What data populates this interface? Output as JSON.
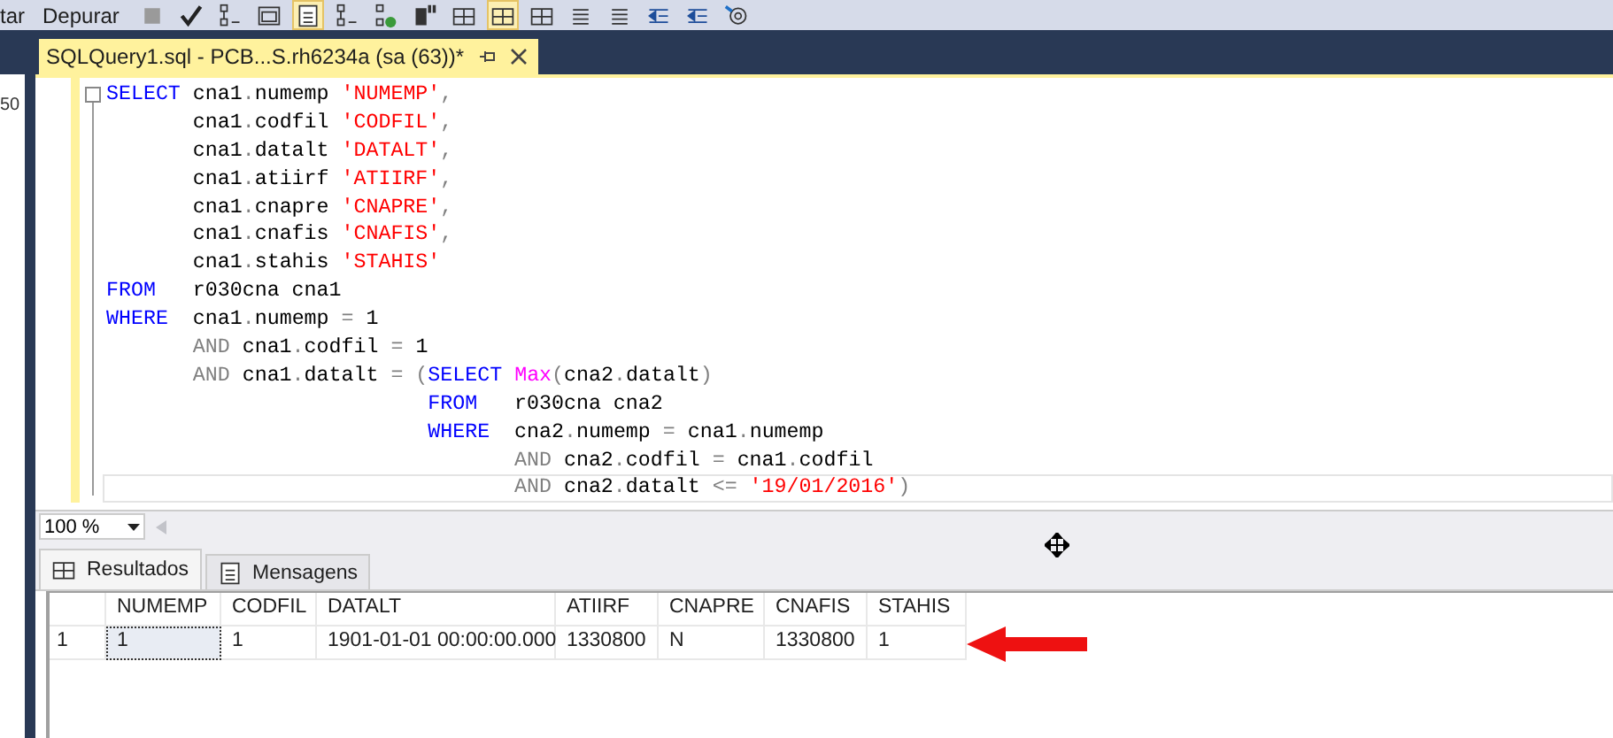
{
  "toolbar": {
    "menus": [
      "tar",
      "Depurar"
    ],
    "buttons": [
      {
        "kind": "stop",
        "on": false
      },
      {
        "kind": "check",
        "on": false
      },
      {
        "kind": "tree",
        "on": false
      },
      {
        "kind": "window",
        "on": false
      },
      {
        "kind": "doc",
        "on": true
      },
      {
        "kind": "tree",
        "on": false
      },
      {
        "kind": "tree-check",
        "on": false
      },
      {
        "kind": "device",
        "on": false
      },
      {
        "kind": "grid",
        "on": false
      },
      {
        "kind": "grid",
        "on": true
      },
      {
        "kind": "grid",
        "on": false
      },
      {
        "kind": "lines",
        "on": false
      },
      {
        "kind": "lines",
        "on": false
      },
      {
        "kind": "indent",
        "on": false
      },
      {
        "kind": "indent",
        "on": false
      },
      {
        "kind": "at",
        "on": false
      }
    ]
  },
  "left_panel": {
    "text": "50"
  },
  "tab": {
    "title": "SQLQuery1.sql - PCB...S.rh6234a (sa (63))*"
  },
  "editor": {
    "lines": [
      {
        "current": false,
        "tokens": [
          {
            "kind": "keyword",
            "text": "SELECT"
          },
          {
            "kind": "plain",
            "text": " cna1"
          },
          {
            "kind": "op",
            "text": "."
          },
          {
            "kind": "plain",
            "text": "numemp "
          },
          {
            "kind": "string",
            "text": "'NUMEMP'"
          },
          {
            "kind": "op",
            "text": ","
          }
        ]
      },
      {
        "current": false,
        "tokens": [
          {
            "kind": "plain",
            "text": "       cna1"
          },
          {
            "kind": "op",
            "text": "."
          },
          {
            "kind": "plain",
            "text": "codfil "
          },
          {
            "kind": "string",
            "text": "'CODFIL'"
          },
          {
            "kind": "op",
            "text": ","
          }
        ]
      },
      {
        "current": false,
        "tokens": [
          {
            "kind": "plain",
            "text": "       cna1"
          },
          {
            "kind": "op",
            "text": "."
          },
          {
            "kind": "plain",
            "text": "datalt "
          },
          {
            "kind": "string",
            "text": "'DATALT'"
          },
          {
            "kind": "op",
            "text": ","
          }
        ]
      },
      {
        "current": false,
        "tokens": [
          {
            "kind": "plain",
            "text": "       cna1"
          },
          {
            "kind": "op",
            "text": "."
          },
          {
            "kind": "plain",
            "text": "atiirf "
          },
          {
            "kind": "string",
            "text": "'ATIIRF'"
          },
          {
            "kind": "op",
            "text": ","
          }
        ]
      },
      {
        "current": false,
        "tokens": [
          {
            "kind": "plain",
            "text": "       cna1"
          },
          {
            "kind": "op",
            "text": "."
          },
          {
            "kind": "plain",
            "text": "cnapre "
          },
          {
            "kind": "string",
            "text": "'CNAPRE'"
          },
          {
            "kind": "op",
            "text": ","
          }
        ]
      },
      {
        "current": false,
        "tokens": [
          {
            "kind": "plain",
            "text": "       cna1"
          },
          {
            "kind": "op",
            "text": "."
          },
          {
            "kind": "plain",
            "text": "cnafis "
          },
          {
            "kind": "string",
            "text": "'CNAFIS'"
          },
          {
            "kind": "op",
            "text": ","
          }
        ]
      },
      {
        "current": false,
        "tokens": [
          {
            "kind": "plain",
            "text": "       cna1"
          },
          {
            "kind": "op",
            "text": "."
          },
          {
            "kind": "plain",
            "text": "stahis "
          },
          {
            "kind": "string",
            "text": "'STAHIS'"
          }
        ]
      },
      {
        "current": false,
        "tokens": [
          {
            "kind": "keyword",
            "text": "FROM"
          },
          {
            "kind": "plain",
            "text": "   r030cna cna1"
          }
        ]
      },
      {
        "current": false,
        "tokens": [
          {
            "kind": "keyword",
            "text": "WHERE"
          },
          {
            "kind": "plain",
            "text": "  cna1"
          },
          {
            "kind": "op",
            "text": "."
          },
          {
            "kind": "plain",
            "text": "numemp "
          },
          {
            "kind": "op",
            "text": "="
          },
          {
            "kind": "plain",
            "text": " 1"
          }
        ]
      },
      {
        "current": false,
        "tokens": [
          {
            "kind": "op",
            "text": "       AND"
          },
          {
            "kind": "plain",
            "text": " cna1"
          },
          {
            "kind": "op",
            "text": "."
          },
          {
            "kind": "plain",
            "text": "codfil "
          },
          {
            "kind": "op",
            "text": "="
          },
          {
            "kind": "plain",
            "text": " 1"
          }
        ]
      },
      {
        "current": false,
        "tokens": [
          {
            "kind": "op",
            "text": "       AND"
          },
          {
            "kind": "plain",
            "text": " cna1"
          },
          {
            "kind": "op",
            "text": "."
          },
          {
            "kind": "plain",
            "text": "datalt "
          },
          {
            "kind": "op",
            "text": "= ("
          },
          {
            "kind": "keyword",
            "text": "SELECT "
          },
          {
            "kind": "function",
            "text": "Max"
          },
          {
            "kind": "op",
            "text": "("
          },
          {
            "kind": "plain",
            "text": "cna2"
          },
          {
            "kind": "op",
            "text": "."
          },
          {
            "kind": "plain",
            "text": "datalt"
          },
          {
            "kind": "op",
            "text": ")"
          }
        ]
      },
      {
        "current": false,
        "tokens": [
          {
            "kind": "keyword",
            "text": "                          FROM"
          },
          {
            "kind": "plain",
            "text": "   r030cna cna2"
          }
        ]
      },
      {
        "current": false,
        "tokens": [
          {
            "kind": "keyword",
            "text": "                          WHERE"
          },
          {
            "kind": "plain",
            "text": "  cna2"
          },
          {
            "kind": "op",
            "text": "."
          },
          {
            "kind": "plain",
            "text": "numemp "
          },
          {
            "kind": "op",
            "text": "="
          },
          {
            "kind": "plain",
            "text": " cna1"
          },
          {
            "kind": "op",
            "text": "."
          },
          {
            "kind": "plain",
            "text": "numemp"
          }
        ]
      },
      {
        "current": false,
        "tokens": [
          {
            "kind": "op",
            "text": "                                 AND"
          },
          {
            "kind": "plain",
            "text": " cna2"
          },
          {
            "kind": "op",
            "text": "."
          },
          {
            "kind": "plain",
            "text": "codfil "
          },
          {
            "kind": "op",
            "text": "="
          },
          {
            "kind": "plain",
            "text": " cna1"
          },
          {
            "kind": "op",
            "text": "."
          },
          {
            "kind": "plain",
            "text": "codfil"
          }
        ]
      },
      {
        "current": true,
        "tokens": [
          {
            "kind": "op",
            "text": "                                 AND"
          },
          {
            "kind": "plain",
            "text": " cna2"
          },
          {
            "kind": "op",
            "text": "."
          },
          {
            "kind": "plain",
            "text": "datalt "
          },
          {
            "kind": "op",
            "text": "<= "
          },
          {
            "kind": "string",
            "text": "'19/01/2016'"
          },
          {
            "kind": "op",
            "text": ")"
          }
        ]
      }
    ]
  },
  "zoom": {
    "value": "100 %"
  },
  "result_tabs": [
    {
      "label": "Resultados",
      "selected": true
    },
    {
      "label": "Mensagens",
      "selected": false
    }
  ],
  "results": {
    "columns": [
      "NUMEMP",
      "CODFIL",
      "DATALT",
      "ATIIRF",
      "CNAPRE",
      "CNAFIS",
      "STAHIS"
    ],
    "rows": [
      {
        "number": "1",
        "cells": [
          {
            "text": "1",
            "selected": true
          },
          {
            "text": "1",
            "selected": false
          },
          {
            "text": "1901-01-01 00:00:00.000",
            "selected": false
          },
          {
            "text": "1330800",
            "selected": false
          },
          {
            "text": "N",
            "selected": false
          },
          {
            "text": "1330800",
            "selected": false
          },
          {
            "text": "1",
            "selected": false
          }
        ]
      }
    ]
  }
}
